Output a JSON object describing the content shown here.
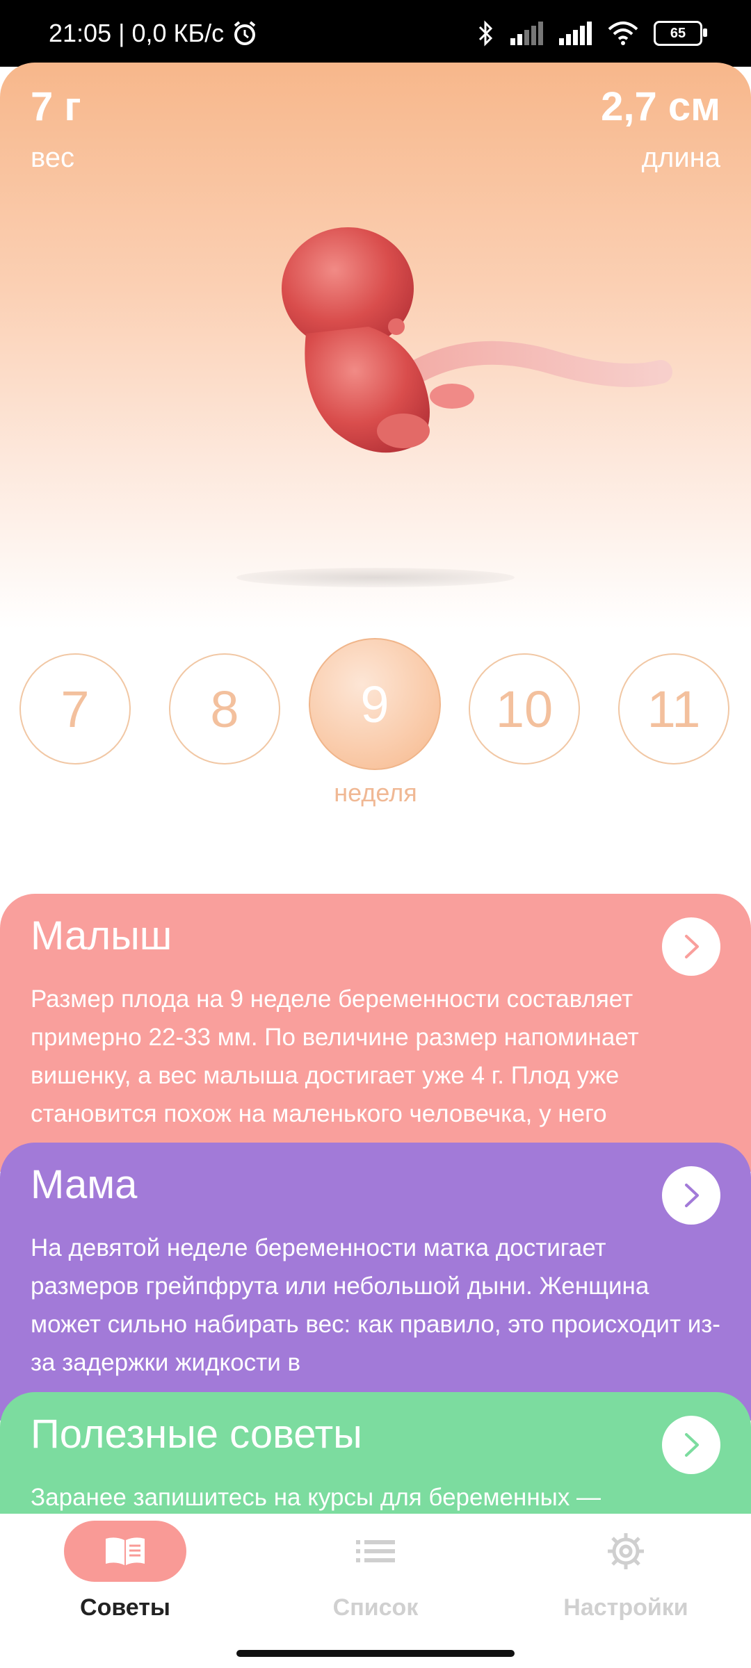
{
  "status_bar": {
    "time_speed": "21:05 | 0,0 КБ/с",
    "battery": "65"
  },
  "stats": {
    "weight_value": "7 г",
    "weight_label": "вес",
    "length_value": "2,7 см",
    "length_label": "длина"
  },
  "weeks": {
    "items": [
      "7",
      "8",
      "9",
      "10",
      "11"
    ],
    "selected": "9",
    "caption": "неделя"
  },
  "cards": [
    {
      "title": "Малыш",
      "text": "Размер плода на 9 неделе беременности составляет примерно 22-33 мм. По величине размер напоминает вишенку, а вес малыша достигает уже 4 г. Плод уже становится похож на маленького человечка, у него",
      "color": "#f99f9c"
    },
    {
      "title": "Мама",
      "text": "На девятой неделе беременности матка достигает размеров грейпфрута или небольшой дыни. Женщина может сильно набирать вес: как правило, это происходит из-за задержки жидкости в",
      "color": "#a27ad8"
    },
    {
      "title": "Полезные советы",
      "text": "Заранее запишитесь на курсы для беременных —",
      "color": "#7cdc9f"
    }
  ],
  "nav": {
    "tips": "Советы",
    "list": "Список",
    "settings": "Настройки",
    "active": "Советы",
    "accent": "#f99a96"
  }
}
